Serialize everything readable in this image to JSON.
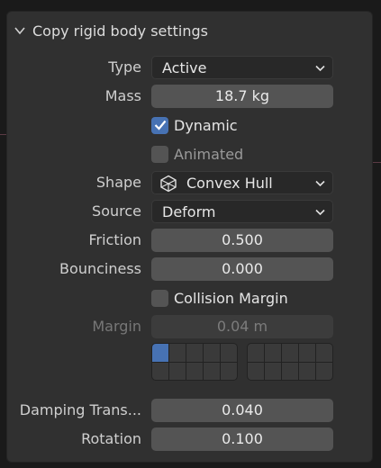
{
  "panel": {
    "title": "Copy rigid body settings"
  },
  "fields": {
    "type": {
      "label": "Type",
      "value": "Active"
    },
    "mass": {
      "label": "Mass",
      "value": "18.7 kg"
    },
    "dynamic": {
      "label": "Dynamic",
      "checked": true
    },
    "animated": {
      "label": "Animated",
      "checked": false
    },
    "shape": {
      "label": "Shape",
      "value": "Convex Hull",
      "icon": "convex-hull-icon"
    },
    "source": {
      "label": "Source",
      "value": "Deform"
    },
    "friction": {
      "label": "Friction",
      "value": "0.500"
    },
    "bounciness": {
      "label": "Bounciness",
      "value": "0.000"
    },
    "collision_margin": {
      "label": "Collision Margin",
      "checked": false
    },
    "margin": {
      "label": "Margin",
      "value": "0.04 m"
    },
    "damping_translation": {
      "label": "Damping Trans...",
      "value": "0.040"
    },
    "rotation": {
      "label": "Rotation",
      "value": "0.100"
    }
  },
  "collections": {
    "left_grid_active": [
      true,
      false,
      false,
      false,
      false,
      false,
      false,
      false,
      false,
      false
    ],
    "right_grid_active": [
      false,
      false,
      false,
      false,
      false,
      false,
      false,
      false,
      false,
      false
    ]
  },
  "colors": {
    "accent": "#4772b3",
    "panel_bg": "#303030",
    "field_bg": "#545454",
    "dropdown_bg": "#282828"
  }
}
